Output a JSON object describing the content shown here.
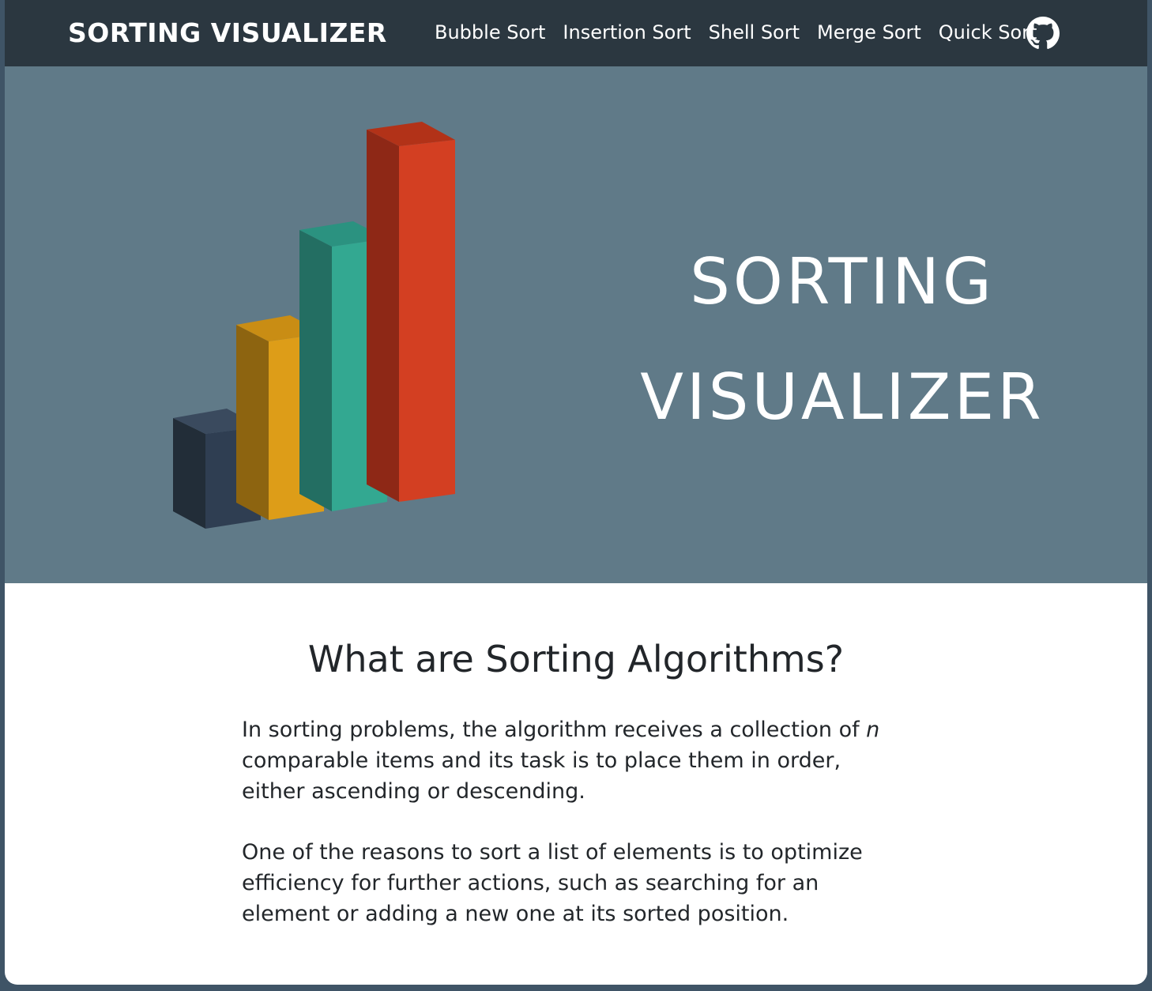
{
  "navbar": {
    "brand": "SORTING VISUALIZER",
    "links": [
      {
        "label": "Bubble Sort"
      },
      {
        "label": "Insertion Sort"
      },
      {
        "label": "Shell Sort"
      },
      {
        "label": "Merge Sort"
      },
      {
        "label": "Quick Sort"
      }
    ],
    "github_icon": "github-icon"
  },
  "hero": {
    "title_line1": "SORTING",
    "title_line2": "VISUALIZER",
    "illustration": "3d-bar-chart-illustration",
    "bar_colors": [
      "#2f3e52",
      "#dd9d18",
      "#33a891",
      "#d33f22"
    ]
  },
  "article": {
    "heading": "What are Sorting Algorithms?",
    "paragraph1_before": "In sorting problems, the algorithm receives a collection of ",
    "paragraph1_var": "n",
    "paragraph1_after": " comparable items and its task is to place them in order, either ascending or descending.",
    "paragraph2": "One of the reasons to sort a list of elements is to optimize efficiency for further actions, such as searching for an element or adding a new one at its sorted position."
  },
  "colors": {
    "navbar_bg": "#2b3740",
    "hero_bg": "#607a88",
    "page_frame": "#3f5466",
    "text": "#22262a"
  }
}
